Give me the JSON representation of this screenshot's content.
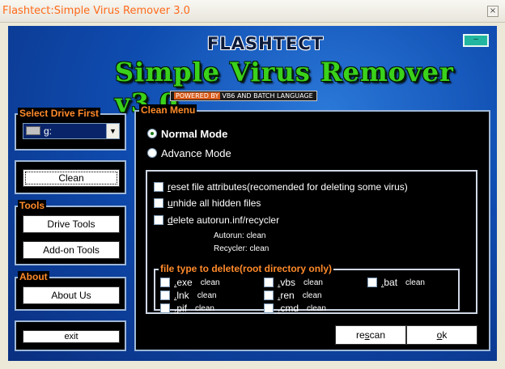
{
  "window": {
    "title": "Flashtect:Simple Virus Remover 3.0",
    "close_glyph": "×"
  },
  "header": {
    "brand": "FLASHTECT",
    "product": "Simple Virus Remover v3.0",
    "powered_by": "POWERED BY",
    "powered_rest": "VB6 AND BATCH LANGUAGE",
    "minimize_glyph": "–"
  },
  "drive_panel": {
    "caption": "Select Drive First",
    "selected": "g:"
  },
  "clean_panel": {
    "clean_label": "Clean"
  },
  "tools_panel": {
    "caption": "Tools",
    "drive_tools_label": "Drive Tools",
    "addon_tools_label": "Add-on Tools"
  },
  "about_panel": {
    "caption": "About",
    "about_us_label": "About Us"
  },
  "exit_panel": {
    "exit_label": "exit"
  },
  "clean_menu": {
    "caption": "Clean Menu",
    "normal_mode": "Normal Mode",
    "advance_mode": "Advance Mode",
    "reset_attr_u": "r",
    "reset_attr_rest": "eset file attributes(recomended for deleting some virus)",
    "unhide_u": "u",
    "unhide_rest": "nhide all hidden files",
    "autorun_u": "d",
    "autorun_rest": "elete autorun.inf/recycler",
    "autorun_status": "Autorun: clean",
    "recycler_status": "Recycler: clean"
  },
  "file_types": {
    "caption": "file type to delete(root directory only)",
    "items": [
      {
        "u": ".",
        "rest": "exe",
        "status": "clean"
      },
      {
        "u": ".",
        "rest": "lnk",
        "status": "clean"
      },
      {
        "u": ".",
        "rest": "pif",
        "status": "clean"
      },
      {
        "u": ".",
        "rest": "vbs",
        "status": "clean"
      },
      {
        "u": ".",
        "rest": "ren",
        "status": "clean"
      },
      {
        "u": ".",
        "rest": "cmd",
        "status": "clean"
      },
      {
        "u": ".",
        "rest": "bat",
        "status": "clean"
      }
    ]
  },
  "actions": {
    "rescan_pre": "re",
    "rescan_u": "s",
    "rescan_post": "can",
    "ok_u": "o",
    "ok_post": "k"
  }
}
